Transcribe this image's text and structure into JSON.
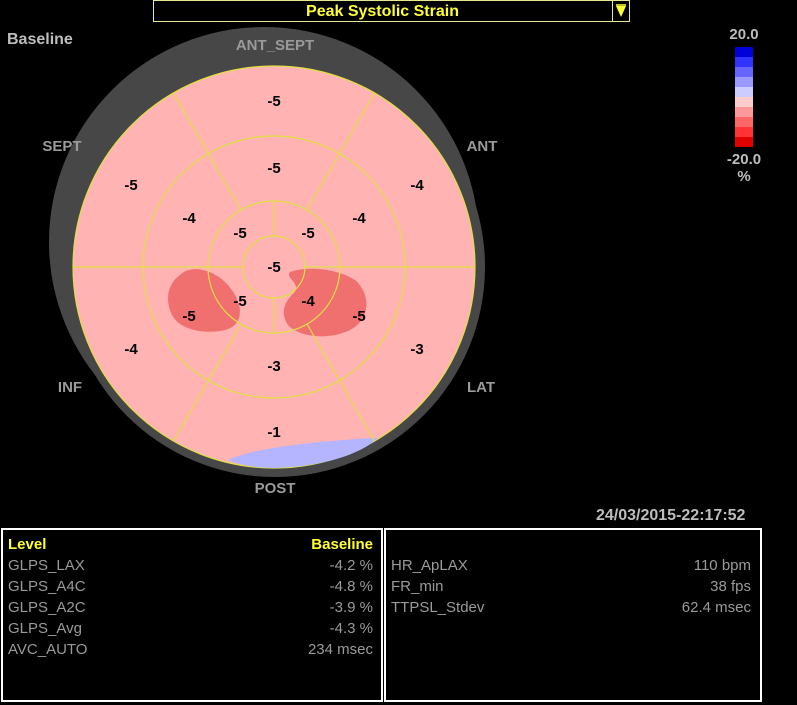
{
  "header": {
    "title": "Peak Systolic Strain"
  },
  "bullseye": {
    "baseline_label": "Baseline",
    "labels": {
      "ant_sept": "ANT_SEPT",
      "sept": "SEPT",
      "ant": "ANT",
      "inf": "INF",
      "lat": "LAT",
      "post": "POST"
    },
    "values": {
      "basal_antsept": "-5",
      "basal_ant": "-4",
      "basal_lat": "-3",
      "basal_post": "-1",
      "basal_inf": "-4",
      "basal_sept": "-5",
      "mid_antsept": "-5",
      "mid_ant": "-4",
      "mid_lat": "-5",
      "mid_post": "-3",
      "mid_inf": "-5",
      "mid_sept": "-4",
      "apex_antsept": "-5",
      "apex_lat": "-4",
      "apex_inf": "-5",
      "apex_sept": "-5",
      "apex_center": "-5"
    }
  },
  "scale": {
    "max": "20.0",
    "min": "-20.0",
    "unit": "%",
    "colors": [
      "#0000d8",
      "#3333ff",
      "#6666ff",
      "#9999ff",
      "#ccccff",
      "#ffcccc",
      "#ff9999",
      "#ff6666",
      "#ff3333",
      "#e00000"
    ]
  },
  "timestamp": "24/03/2015-22:17:52",
  "left_panel": {
    "header_left": "Level",
    "header_right": "Baseline",
    "rows": [
      {
        "label": "GLPS_LAX",
        "value": "-4.2 %"
      },
      {
        "label": "GLPS_A4C",
        "value": "-4.8 %"
      },
      {
        "label": "GLPS_A2C",
        "value": "-3.9 %"
      },
      {
        "label": "GLPS_Avg",
        "value": "-4.3 %"
      },
      {
        "label": "AVC_AUTO",
        "value": "234 msec"
      }
    ]
  },
  "right_panel": {
    "rows": [
      {
        "label": "HR_ApLAX",
        "value": "110 bpm"
      },
      {
        "label": "FR_min",
        "value": "38 fps"
      },
      {
        "label": "TTPSL_Stdev",
        "value": "62.4 msec"
      }
    ]
  },
  "colors": {
    "segment_fill": "#ffb3b3",
    "segment_line": "#e0e040",
    "dark_patch": "#f07070",
    "blue_patch": "#b4b4ff",
    "ring": "#474747",
    "title_text": "#ffff33"
  }
}
